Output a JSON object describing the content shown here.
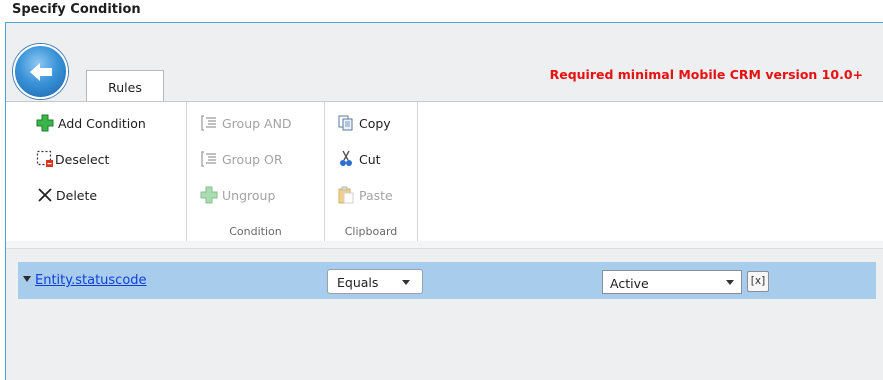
{
  "window": {
    "title": "Specify Condition"
  },
  "tabs": [
    {
      "label": "Rules",
      "active": true
    }
  ],
  "version_note": "Required minimal Mobile CRM version 10.0+",
  "ribbon": {
    "groups": [
      {
        "name": "",
        "items": [
          {
            "label": "Add Condition",
            "icon": "add-icon",
            "enabled": true
          },
          {
            "label": "Deselect",
            "icon": "deselect-icon",
            "enabled": true
          },
          {
            "label": "Delete",
            "icon": "delete-icon",
            "enabled": true
          }
        ]
      },
      {
        "name": "Condition",
        "items": [
          {
            "label": "Group AND",
            "icon": "group-and-icon",
            "enabled": false
          },
          {
            "label": "Group OR",
            "icon": "group-or-icon",
            "enabled": false
          },
          {
            "label": "Ungroup",
            "icon": "ungroup-icon",
            "enabled": false
          }
        ]
      },
      {
        "name": "Clipboard",
        "items": [
          {
            "label": "Copy",
            "icon": "copy-icon",
            "enabled": true
          },
          {
            "label": "Cut",
            "icon": "cut-icon",
            "enabled": true
          },
          {
            "label": "Paste",
            "icon": "paste-icon",
            "enabled": false
          }
        ]
      }
    ]
  },
  "condition": {
    "field": "Entity.statuscode",
    "operator": "Equals",
    "value": "Active",
    "clear_label": "[x]"
  },
  "colors": {
    "accent": "#4ba4d8",
    "warning": "#e81010",
    "row_highlight": "#a8ccec",
    "link": "#0f3fd9"
  }
}
